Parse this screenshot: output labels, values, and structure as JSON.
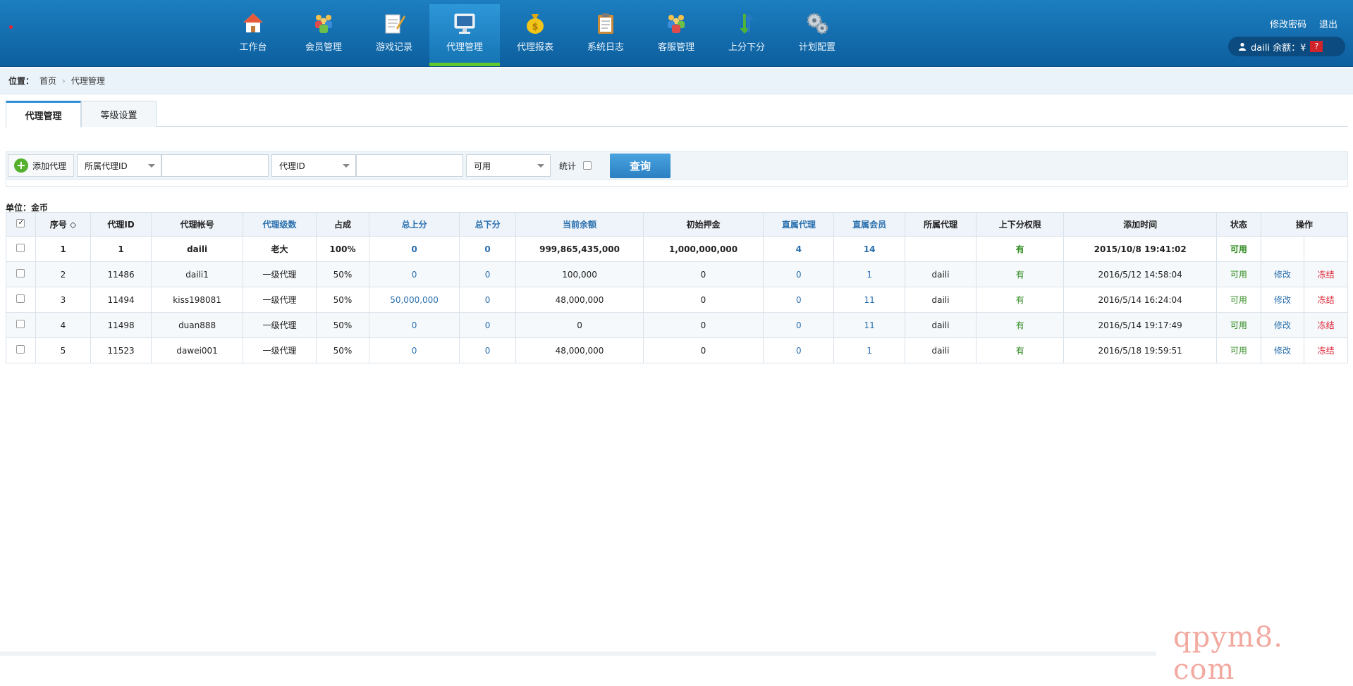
{
  "nav": {
    "items": [
      {
        "label": "工作台",
        "icon": "home-icon"
      },
      {
        "label": "会员管理",
        "icon": "members-icon"
      },
      {
        "label": "游戏记录",
        "icon": "notepad-icon"
      },
      {
        "label": "代理管理",
        "icon": "monitor-icon",
        "active": true
      },
      {
        "label": "代理报表",
        "icon": "money-bag-icon"
      },
      {
        "label": "系统日志",
        "icon": "clipboard-icon"
      },
      {
        "label": "客服管理",
        "icon": "people-icon"
      },
      {
        "label": "上分下分",
        "icon": "arrows-icon"
      },
      {
        "label": "计划配置",
        "icon": "gears-icon"
      }
    ],
    "change_password": "修改密码",
    "logout": "退出",
    "user": "daili 余额：¥",
    "balance": "?"
  },
  "breadcrumb": {
    "label": "位置：",
    "home": "首页",
    "current": "代理管理"
  },
  "tabs": [
    "代理管理",
    "等级设置"
  ],
  "toolbar": {
    "add_label": "添加代理",
    "filter1": "所属代理ID",
    "filter2": "代理ID",
    "filter3": "可用",
    "stat_label": "统计",
    "query_label": "查询"
  },
  "unit_label": "单位：金币",
  "table": {
    "headers": [
      "序号 ◇",
      "代理ID",
      "代理帐号",
      "代理级数",
      "占成",
      "总上分",
      "总下分",
      "当前余额",
      "初始押金",
      "直属代理",
      "直属会员",
      "所属代理",
      "上下分权限",
      "添加时间",
      "状态",
      "操作"
    ],
    "rows": [
      {
        "no": "1",
        "id": "1",
        "account": "daili",
        "level": "老大",
        "share": "100%",
        "up": "0",
        "down": "0",
        "balance": "999,865,435,000",
        "deposit": "1,000,000,000",
        "agents": "4",
        "members": "14",
        "parent": "",
        "perm": "有",
        "time": "2015/10/8 19:41:02",
        "status": "可用",
        "edit": "",
        "freeze": ""
      },
      {
        "no": "2",
        "id": "11486",
        "account": "daili1",
        "level": "一级代理",
        "share": "50%",
        "up": "0",
        "down": "0",
        "balance": "100,000",
        "deposit": "0",
        "agents": "0",
        "members": "1",
        "parent": "daili",
        "perm": "有",
        "time": "2016/5/12 14:58:04",
        "status": "可用",
        "edit": "修改",
        "freeze": "冻结"
      },
      {
        "no": "3",
        "id": "11494",
        "account": "kiss198081",
        "level": "一级代理",
        "share": "50%",
        "up": "50,000,000",
        "down": "0",
        "balance": "48,000,000",
        "deposit": "0",
        "agents": "0",
        "members": "11",
        "parent": "daili",
        "perm": "有",
        "time": "2016/5/14 16:24:04",
        "status": "可用",
        "edit": "修改",
        "freeze": "冻结"
      },
      {
        "no": "4",
        "id": "11498",
        "account": "duan888",
        "level": "一级代理",
        "share": "50%",
        "up": "0",
        "down": "0",
        "balance": "0",
        "deposit": "0",
        "agents": "0",
        "members": "11",
        "parent": "daili",
        "perm": "有",
        "time": "2016/5/14 19:17:49",
        "status": "可用",
        "edit": "修改",
        "freeze": "冻结"
      },
      {
        "no": "5",
        "id": "11523",
        "account": "dawei001",
        "level": "一级代理",
        "share": "50%",
        "up": "0",
        "down": "0",
        "balance": "48,000,000",
        "deposit": "0",
        "agents": "0",
        "members": "1",
        "parent": "daili",
        "perm": "有",
        "time": "2016/5/18 19:59:51",
        "status": "可用",
        "edit": "修改",
        "freeze": "冻结"
      }
    ]
  },
  "watermark": "qpym8. com",
  "colors": {
    "nav_bg": "#1c7ec0",
    "active_underline": "#5fc82c",
    "link_blue": "#2a6fae",
    "green": "#2e8b1f",
    "red": "#dd2233"
  }
}
